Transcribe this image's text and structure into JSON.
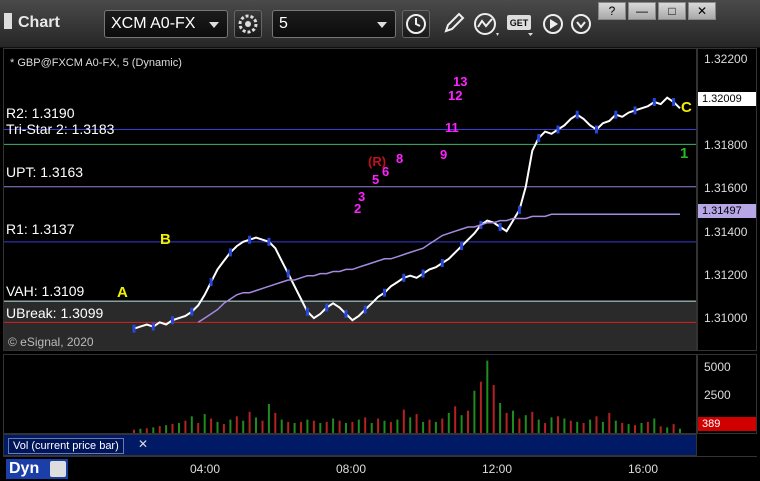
{
  "toolbar": {
    "title": "Chart",
    "symbol": "XCM A0-FX",
    "interval": "5",
    "window_buttons": [
      "?",
      "—",
      "□",
      "✕"
    ]
  },
  "chart_data": {
    "type": "line",
    "title": "* GBP@FXCM A0-FX, 5 (Dynamic)",
    "copyright": "© eSignal, 2020",
    "ylim": [
      1.3085,
      1.3228
    ],
    "y_ticks": [
      "1.32200",
      "1.31800",
      "1.31600",
      "1.31400",
      "1.31200",
      "1.31000"
    ],
    "last_price_tag": "1.32009",
    "ma_tag": "1.31497",
    "x_ticks": [
      "04:00",
      "08:00",
      "12:00",
      "16:00"
    ],
    "levels": [
      {
        "label": "R2: 1.3190",
        "value": 1.319,
        "color": "#3b3bd6"
      },
      {
        "label": "Tri-Star 2: 1.3183",
        "value": 1.3183,
        "color": "#3bb36b"
      },
      {
        "label": "UPT: 1.3163",
        "value": 1.3163,
        "color": "#9a7fd9"
      },
      {
        "label": "R1: 1.3137",
        "value": 1.3137,
        "color": "#3b3bd6"
      },
      {
        "label": "VAH: 1.3109",
        "value": 1.3109,
        "color": "#bfe7e7"
      },
      {
        "label": "UBreak: 1.3099",
        "value": 1.3099,
        "color": "#d62020"
      }
    ],
    "markers": [
      "A",
      "B",
      "C",
      "1",
      "3",
      "2",
      "5",
      "6",
      "8",
      "9",
      "11",
      "12",
      "13",
      "(R)"
    ],
    "series": [
      {
        "values": [
          1.3096,
          1.3097,
          1.3098,
          1.3097,
          1.3099,
          1.3098,
          1.31,
          1.3101,
          1.3102,
          1.3104,
          1.3107,
          1.3112,
          1.3118,
          1.3124,
          1.3128,
          1.3132,
          1.3135,
          1.3137,
          1.3138,
          1.3139,
          1.3138,
          1.3137,
          1.3134,
          1.3128,
          1.3122,
          1.3116,
          1.311,
          1.3104,
          1.3101,
          1.3103,
          1.3106,
          1.3108,
          1.3106,
          1.3103,
          1.31,
          1.3102,
          1.3105,
          1.3108,
          1.3111,
          1.3113,
          1.3116,
          1.3118,
          1.312,
          1.3121,
          1.312,
          1.3122,
          1.3124,
          1.3125,
          1.3127,
          1.3129,
          1.3132,
          1.3135,
          1.3138,
          1.3141,
          1.3145,
          1.3147,
          1.3146,
          1.3144,
          1.3142,
          1.3147,
          1.3152,
          1.3163,
          1.318,
          1.3186,
          1.3189,
          1.3188,
          1.319,
          1.3192,
          1.3195,
          1.3197,
          1.3195,
          1.3192,
          1.319,
          1.3193,
          1.3194,
          1.3197,
          1.3196,
          1.3198,
          1.3199,
          1.32,
          1.3201,
          1.3203,
          1.3202,
          1.3205,
          1.3203,
          1.32
        ]
      },
      {
        "values": [
          null,
          null,
          null,
          null,
          null,
          null,
          null,
          null,
          null,
          null,
          1.3099,
          1.3101,
          1.3103,
          1.3105,
          1.3108,
          1.311,
          1.3112,
          1.3113,
          1.3113,
          1.3114,
          1.3115,
          1.3116,
          1.3117,
          1.3118,
          1.3119,
          1.3119,
          1.312,
          1.3121,
          1.3121,
          1.3122,
          1.3122,
          1.3123,
          1.3123,
          1.3124,
          1.3124,
          1.3125,
          1.3126,
          1.3127,
          1.3128,
          1.3129,
          1.3129,
          1.313,
          1.3131,
          1.3132,
          1.3133,
          1.3134,
          1.3136,
          1.3138,
          1.314,
          1.3141,
          1.3142,
          1.3143,
          1.3144,
          1.3144,
          1.3145,
          1.3146,
          1.3146,
          1.3147,
          1.3147,
          1.3148,
          1.3148,
          1.3148,
          1.3149,
          1.3149,
          1.3149,
          1.315,
          1.315,
          1.315,
          1.315,
          1.315,
          1.315,
          1.315,
          1.315,
          1.315,
          1.315,
          1.315,
          1.315,
          1.315,
          1.315,
          1.315,
          1.315,
          1.315,
          1.315,
          1.315,
          1.315,
          1.315
        ]
      }
    ]
  },
  "volume": {
    "label": "Vol (current price bar)",
    "y_ticks": [
      "5000",
      "2500"
    ],
    "current_tag": "389",
    "values": [
      300,
      380,
      420,
      500,
      620,
      700,
      820,
      900,
      1100,
      1500,
      900,
      1700,
      1300,
      1000,
      800,
      1200,
      1500,
      1100,
      1900,
      1400,
      1100,
      2600,
      1800,
      1200,
      1000,
      900,
      1000,
      1200,
      1100,
      900,
      1000,
      1300,
      1100,
      900,
      1000,
      1200,
      1400,
      900,
      1300,
      1100,
      1000,
      1200,
      2100,
      1400,
      1700,
      1000,
      1200,
      1000,
      1300,
      1800,
      2400,
      1600,
      2000,
      3800,
      4600,
      6500,
      4300,
      2700,
      1800,
      2000,
      1300,
      1600,
      1900,
      1200,
      900,
      1400,
      1500,
      1300,
      1100,
      1000,
      900,
      1200,
      1500,
      1000,
      1800,
      1100,
      900,
      800,
      700,
      900,
      1000,
      1300,
      600,
      500,
      800,
      389
    ]
  },
  "footer": {
    "mode": "Dyn"
  }
}
